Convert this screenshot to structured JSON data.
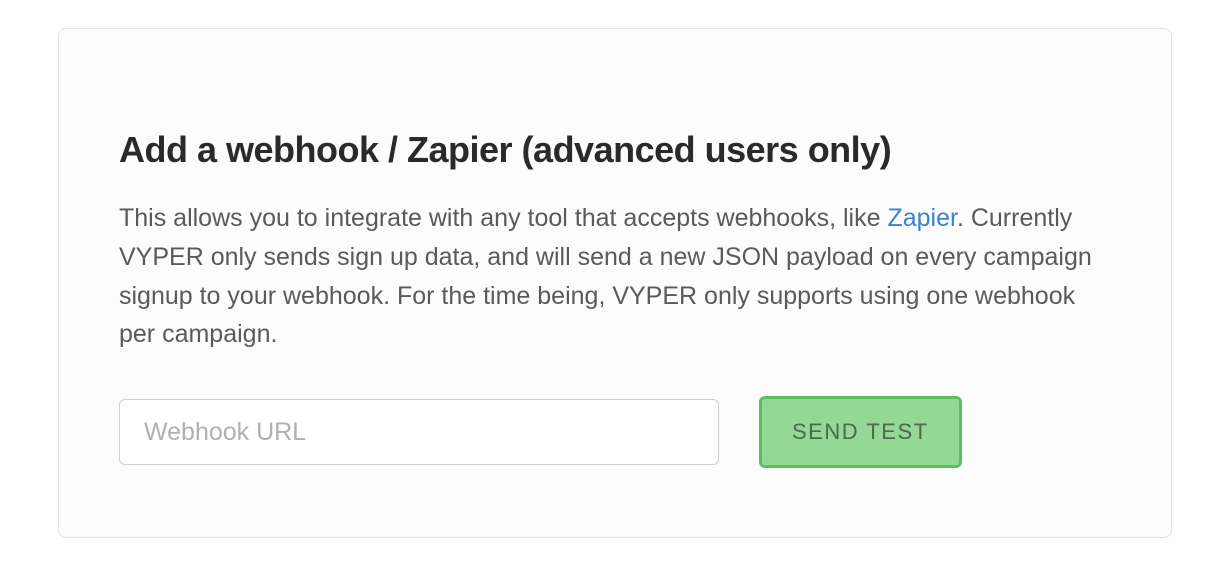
{
  "card": {
    "heading": "Add a webhook / Zapier (advanced users only)",
    "description_pre": "This allows you to integrate with any tool that accepts webhooks, like ",
    "description_link": "Zapier",
    "description_post": ". Currently VYPER only sends sign up data, and will send a new JSON payload on every campaign signup to your webhook. For the time being, VYPER only supports using one webhook per campaign.",
    "input": {
      "placeholder": "Webhook URL",
      "value": ""
    },
    "button_label": "SEND TEST"
  }
}
